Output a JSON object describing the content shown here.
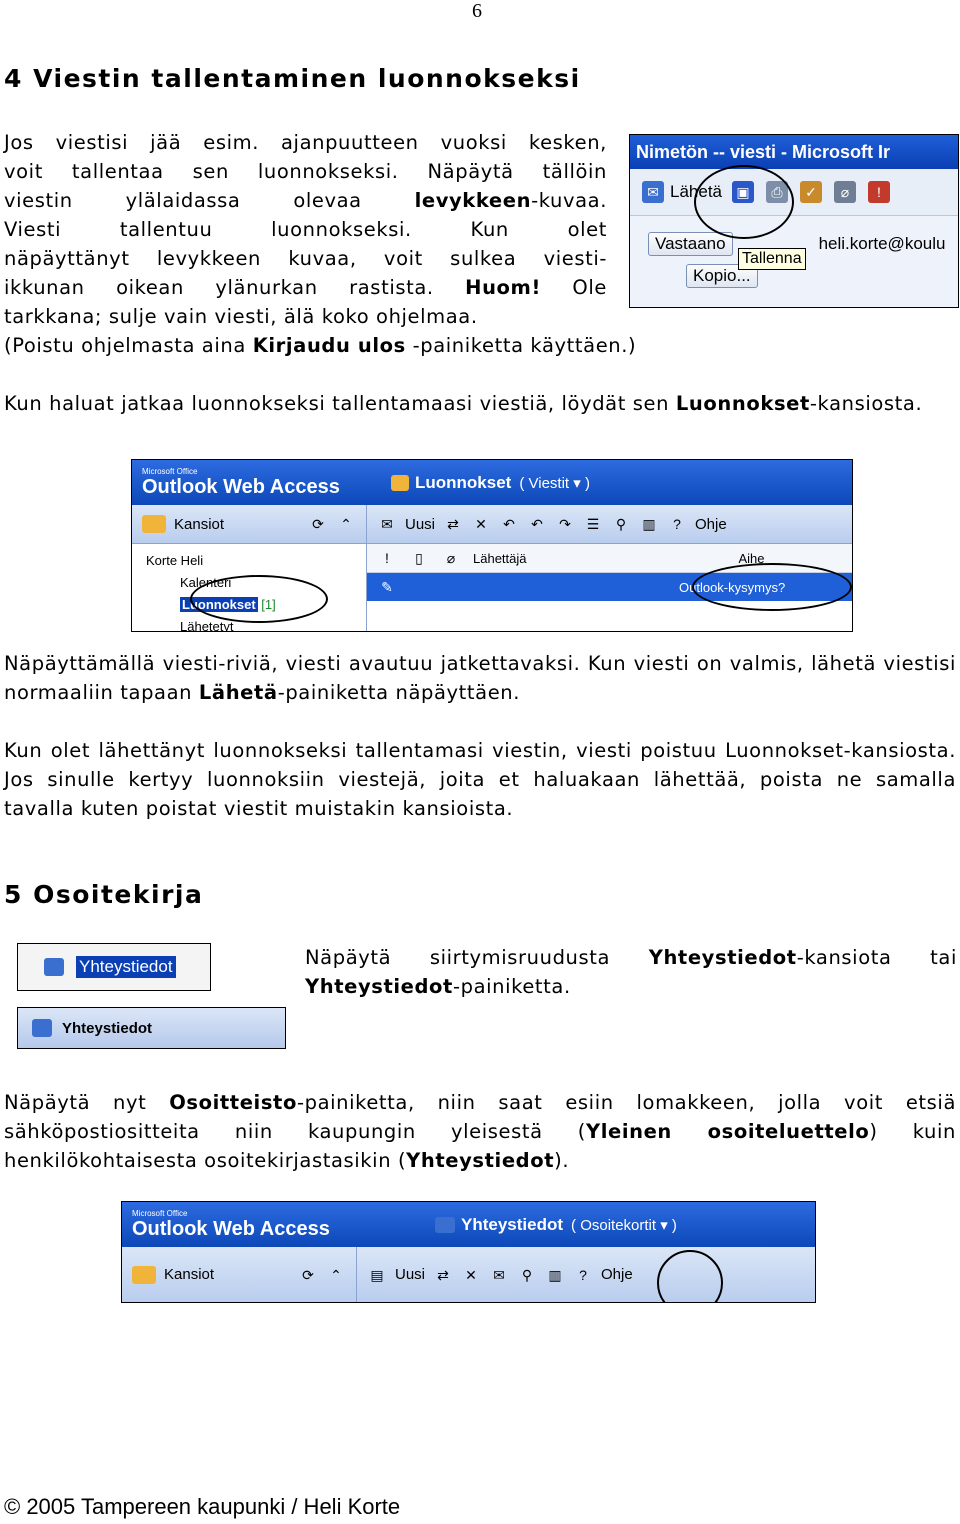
{
  "page_number": "6",
  "section4": {
    "heading": "4 Viestin tallentaminen luonnokseksi",
    "p1_lines": [
      "Jos viestisi jää esim. ajanpuutteen vuoksi kesken,",
      "voit tallentaa sen luonnokseksi. Näpäytä tällöin",
      "Viesti tallentuu luonnokseksi. Kun olet",
      "näpäyttänyt levykkeen kuvaa, voit sulkea viesti-",
      "ikkunan oikean ylänurkan rastista."
    ],
    "p1_line3_pre": "viestin ylälaidassa olevaa ",
    "p1_line3_bold": "levykkeen",
    "p1_line3_post": "-kuvaa.",
    "p1_huom": "Huom!",
    "p1_huom_post": " Ole",
    "p1_line7": "tarkkana; sulje vain viesti, älä koko ohjelmaa.",
    "p1_line8_pre": "(Poistu ohjelmasta aina ",
    "p1_line8_bold": "Kirjaudu ulos",
    "p1_line8_post": " -painiketta käyttäen.)",
    "p2_pre": "Kun haluat jatkaa luonnokseksi tallentamaasi viestiä, löydät sen ",
    "p2_bold": "Luonnokset",
    "p2_post": "-kansiosta.",
    "p3_pre": "Näpäyttämällä viesti-riviä, viesti avautuu jatkettavaksi. Kun viesti on valmis, lähetä viestisi normaaliin tapaan ",
    "p3_bold": "Lähetä",
    "p3_post": "-painiketta näpäyttäen.",
    "p4": "Kun olet lähettänyt luonnokseksi tallentamasi viestin, viesti poistuu Luonnokset-kansiosta. Jos sinulle kertyy luonnoksiin viestejä, joita et haluakaan lähettää, poista ne samalla tavalla kuten poistat viestit muistakin kansioista."
  },
  "section5": {
    "heading": "5 Osoitekirja",
    "p5_pre": "Näpäytä siirtymisruudusta ",
    "p5_bold1": "Yhteystiedot",
    "p5_mid": "-kansiota tai ",
    "p5_bold2": "Yhteystiedot",
    "p5_post": "-painiketta.",
    "p6_pre": "Näpäytä nyt ",
    "p6_bold1": "Osoitteisto",
    "p6_mid1": "-painiketta, niin saat esiin lomakkeen, jolla voit etsiä sähköpostiositteita niin kaupungin yleisestä (",
    "p6_bold2": "Yleinen osoiteluettelo",
    "p6_mid2": ") kuin henkilökohtaisesta osoitekirjastasikin (",
    "p6_bold3": "Yhteystiedot",
    "p6_post": ")."
  },
  "screenshot_message": {
    "title": "Nimetön -- viesti - Microsoft Ir",
    "send_label": "Lähetä",
    "to_button": "Vastaano",
    "to_value": "heli.korte@koulu",
    "cc_button": "Kopio...",
    "tooltip": "Tallenna",
    "icons": [
      "send-icon",
      "save-icon",
      "print-icon",
      "spellcheck-icon",
      "attach-icon",
      "importance-icon"
    ]
  },
  "screenshot_drafts": {
    "brand_small": "Microsoft Office",
    "brand": "Outlook Web Access",
    "folder_title": "Luonnokset",
    "folder_sub": "( Viestit ▾ )",
    "folders_label": "Kansiot",
    "new_label": "Uusi",
    "help_label": "Ohje",
    "tree": [
      "Korte Heli",
      "Kalenteri",
      "Luonnokset",
      "[1]",
      "Lähetetyt"
    ],
    "col_from": "Lähettäjä",
    "col_subject": "Aihe",
    "message_subject": "Outlook-kysymys?"
  },
  "buttons_contacts": {
    "nav_label": "Yhteystiedot",
    "button_label": "Yhteystiedot"
  },
  "screenshot_contacts": {
    "brand_small": "Microsoft Office",
    "brand": "Outlook Web Access",
    "folder_title": "Yhteystiedot",
    "folder_sub": "( Osoitekortit ▾ )",
    "folders_label": "Kansiot",
    "new_label": "Uusi",
    "help_label": "Ohje"
  },
  "footer": "© 2005 Tampereen kaupunki / Heli Korte"
}
